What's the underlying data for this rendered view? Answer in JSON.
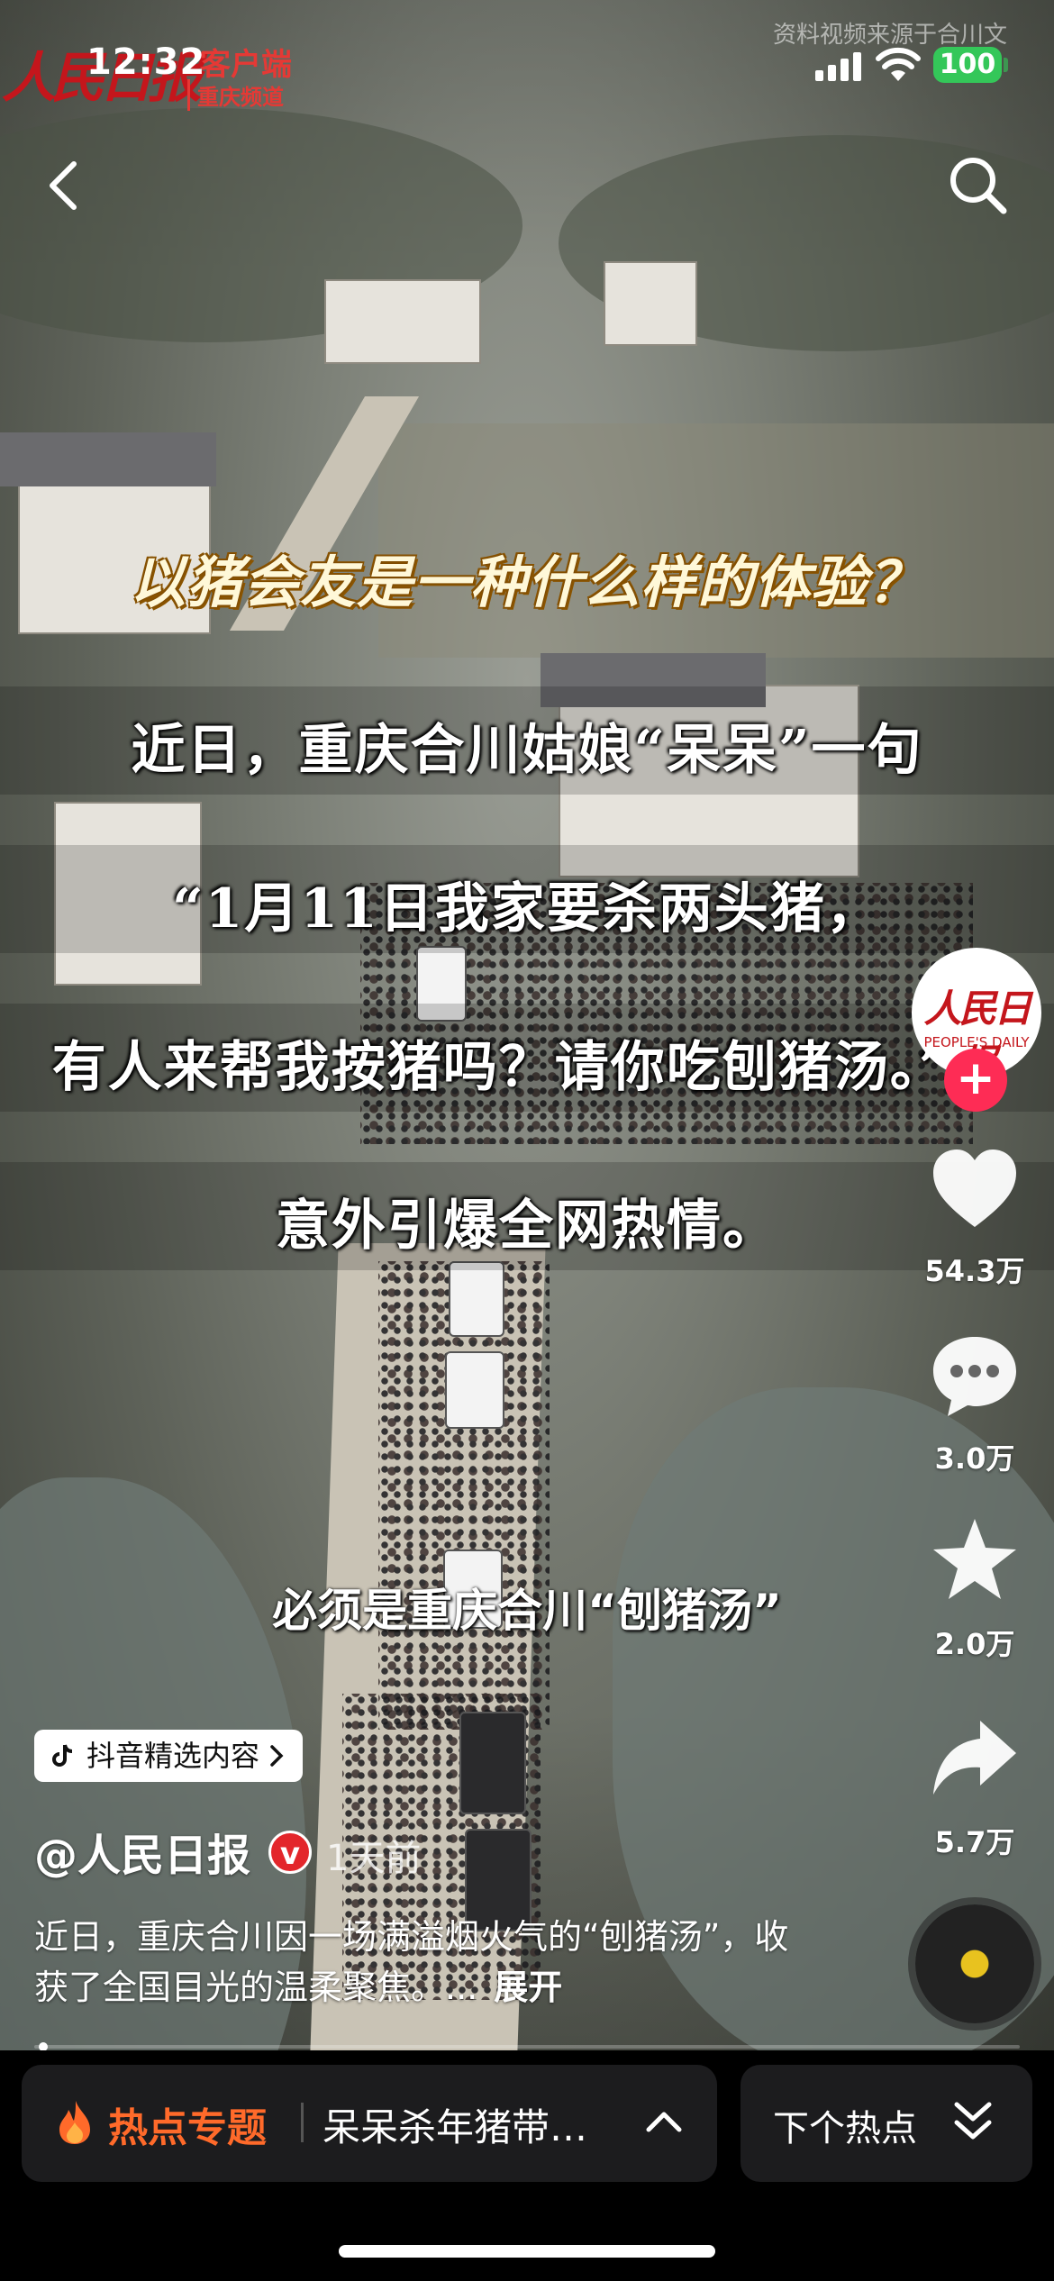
{
  "status_bar": {
    "time": "12:32",
    "battery": "100"
  },
  "watermark": {
    "logo_script": "人民日报",
    "app_label": "客户端",
    "sub_label": "重庆频道",
    "source": "资料视频来源于合川文"
  },
  "captions": {
    "title": "以猪会友是一种什么样的体验？",
    "lines": [
      "近日，重庆合川姑娘“呆呆”一句",
      "“1月11日我家要杀两头猪，",
      "有人来帮我按猪吗？请你吃刨猪汤。”",
      "意外引爆全网热情。"
    ],
    "lower": "必须是重庆合川“刨猪汤”"
  },
  "rail": {
    "avatar_text": "人民日报",
    "avatar_en": "PEOPLE'S DAILY",
    "likes": "54.3万",
    "comments": "3.0万",
    "favorites": "2.0万",
    "shares": "5.7万"
  },
  "post": {
    "tag": "抖音精选内容",
    "author": "@人民日报",
    "time": "1天前",
    "description": "近日，重庆合川因一场满溢烟火气的“刨猪汤”，收获了全国目光的温柔聚焦。...",
    "expand": "展开",
    "progress": 0.005
  },
  "bottom": {
    "hot_label": "热点专题",
    "hot_topic": "呆呆杀年猪带…",
    "next_label": "下个热点"
  },
  "colors": {
    "accent_red": "#fe2c55",
    "hot_orange": "#ff6a2a",
    "battery_green": "#34c759"
  }
}
